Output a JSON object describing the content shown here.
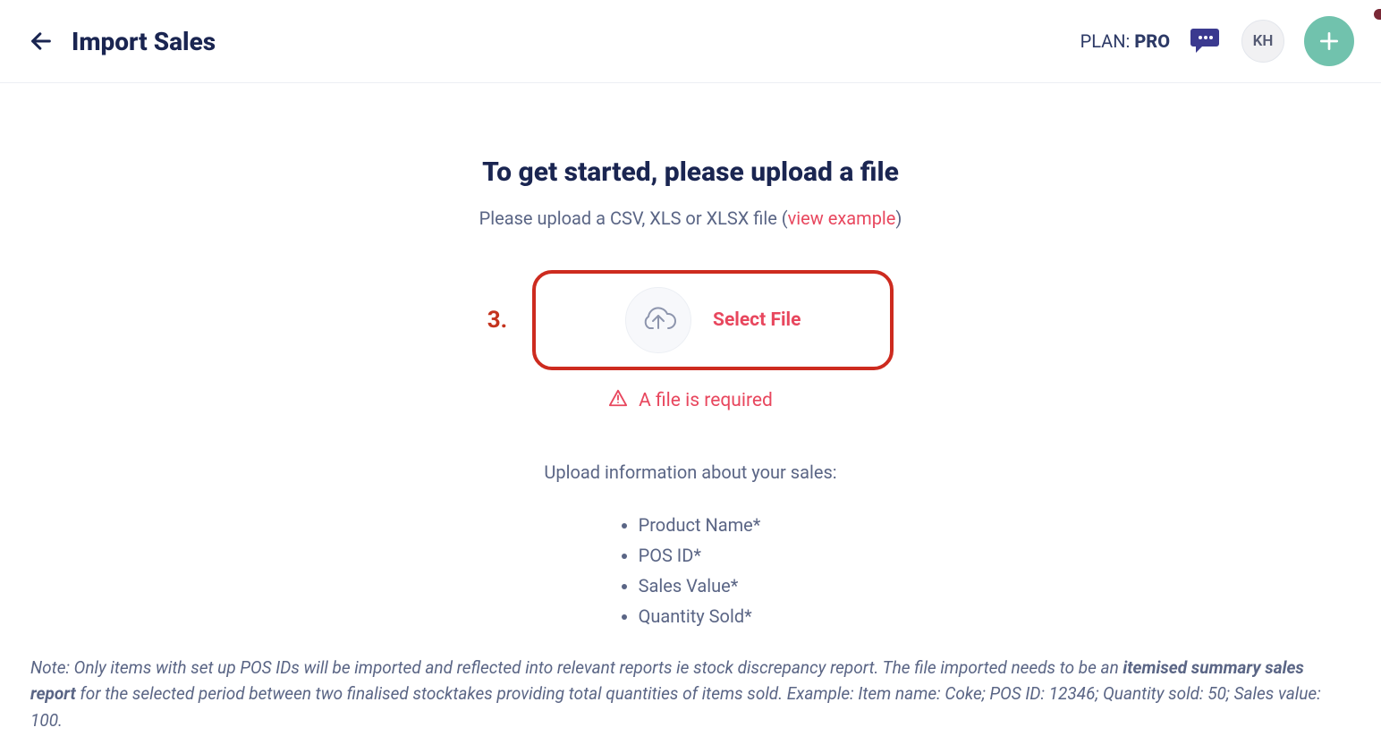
{
  "header": {
    "title": "Import Sales",
    "plan_label": "PLAN: ",
    "plan_value": "PRO",
    "avatar_initials": "KH"
  },
  "main": {
    "headline": "To get started, please upload a file",
    "subtext_prefix": "Please upload a CSV, XLS or XLSX file (",
    "view_example": "view example",
    "subtext_suffix": ")",
    "step_number": "3.",
    "select_file": "Select File",
    "error_text": "A file is required",
    "info_line": "Upload information about your sales:",
    "requirements": [
      "Product Name*",
      "POS ID*",
      "Sales Value*",
      "Quantity Sold*"
    ]
  },
  "note": {
    "prefix": "Note: Only items with set up POS IDs will be imported and reflected into relevant reports ie stock discrepancy report. The file imported needs to be an ",
    "bold": "itemised summary sales report",
    "suffix": " for the selected period between two finalised stocktakes providing total quantities of items sold. Example: Item name: Coke; POS ID: 12346; Quantity sold: 50; Sales value: 100."
  }
}
